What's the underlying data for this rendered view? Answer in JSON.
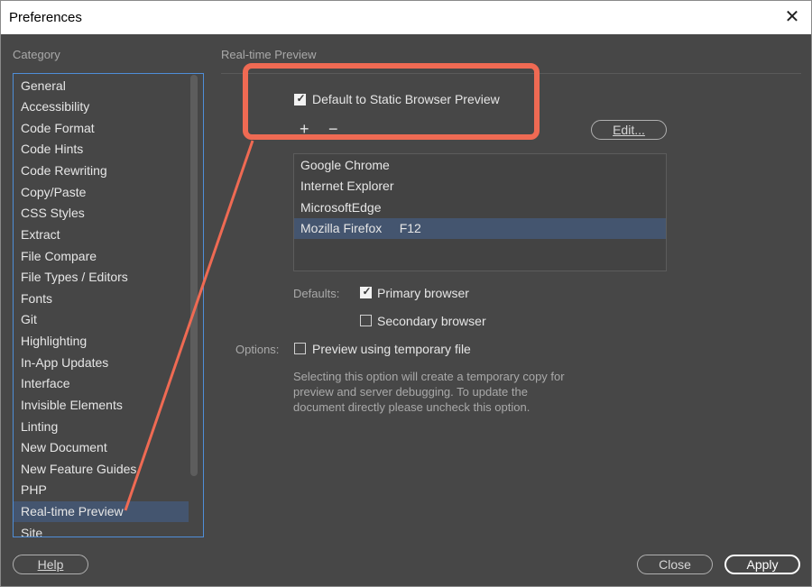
{
  "window": {
    "title": "Preferences"
  },
  "sidebar": {
    "heading": "Category",
    "items": [
      {
        "label": "General"
      },
      {
        "label": "Accessibility"
      },
      {
        "label": "Code Format"
      },
      {
        "label": "Code Hints"
      },
      {
        "label": "Code Rewriting"
      },
      {
        "label": "Copy/Paste"
      },
      {
        "label": "CSS Styles"
      },
      {
        "label": "Extract"
      },
      {
        "label": "File Compare"
      },
      {
        "label": "File Types / Editors"
      },
      {
        "label": "Fonts"
      },
      {
        "label": "Git"
      },
      {
        "label": "Highlighting"
      },
      {
        "label": "In-App Updates"
      },
      {
        "label": "Interface"
      },
      {
        "label": "Invisible Elements"
      },
      {
        "label": "Linting"
      },
      {
        "label": "New Document"
      },
      {
        "label": "New Feature Guides"
      },
      {
        "label": "PHP"
      },
      {
        "label": "Real-time Preview"
      },
      {
        "label": "Site"
      }
    ],
    "selected": "Real-time Preview"
  },
  "panel": {
    "heading": "Real-time Preview",
    "static_preview": {
      "label": "Default to Static Browser Preview",
      "checked": true
    },
    "add_icon": "plus-icon",
    "remove_icon": "minus-icon",
    "add_glyph": "+",
    "remove_glyph": "−",
    "edit_button": "Edit...",
    "browsers": [
      {
        "label": "Google Chrome"
      },
      {
        "label": "Internet Explorer"
      },
      {
        "label": "MicrosoftEdge"
      },
      {
        "label": "Mozilla Firefox     F12"
      }
    ],
    "selected_browser": "Mozilla Firefox",
    "defaults_label": "Defaults:",
    "primary_browser": {
      "label": "Primary browser",
      "checked": true
    },
    "secondary_browser": {
      "label": "Secondary browser",
      "checked": false
    },
    "options_label": "Options:",
    "temp_file": {
      "label": "Preview using temporary file",
      "checked": false
    },
    "description": "Selecting this option will create a temporary copy for preview and server debugging. To update the document directly please uncheck this option."
  },
  "footer": {
    "help_button": "Help",
    "close_button": "Close",
    "apply_button": "Apply"
  },
  "colors": {
    "dialog_bg": "#474747",
    "selection": "#44556f",
    "annotation": "#ef6a53",
    "focus_border": "#4f8ed8"
  }
}
